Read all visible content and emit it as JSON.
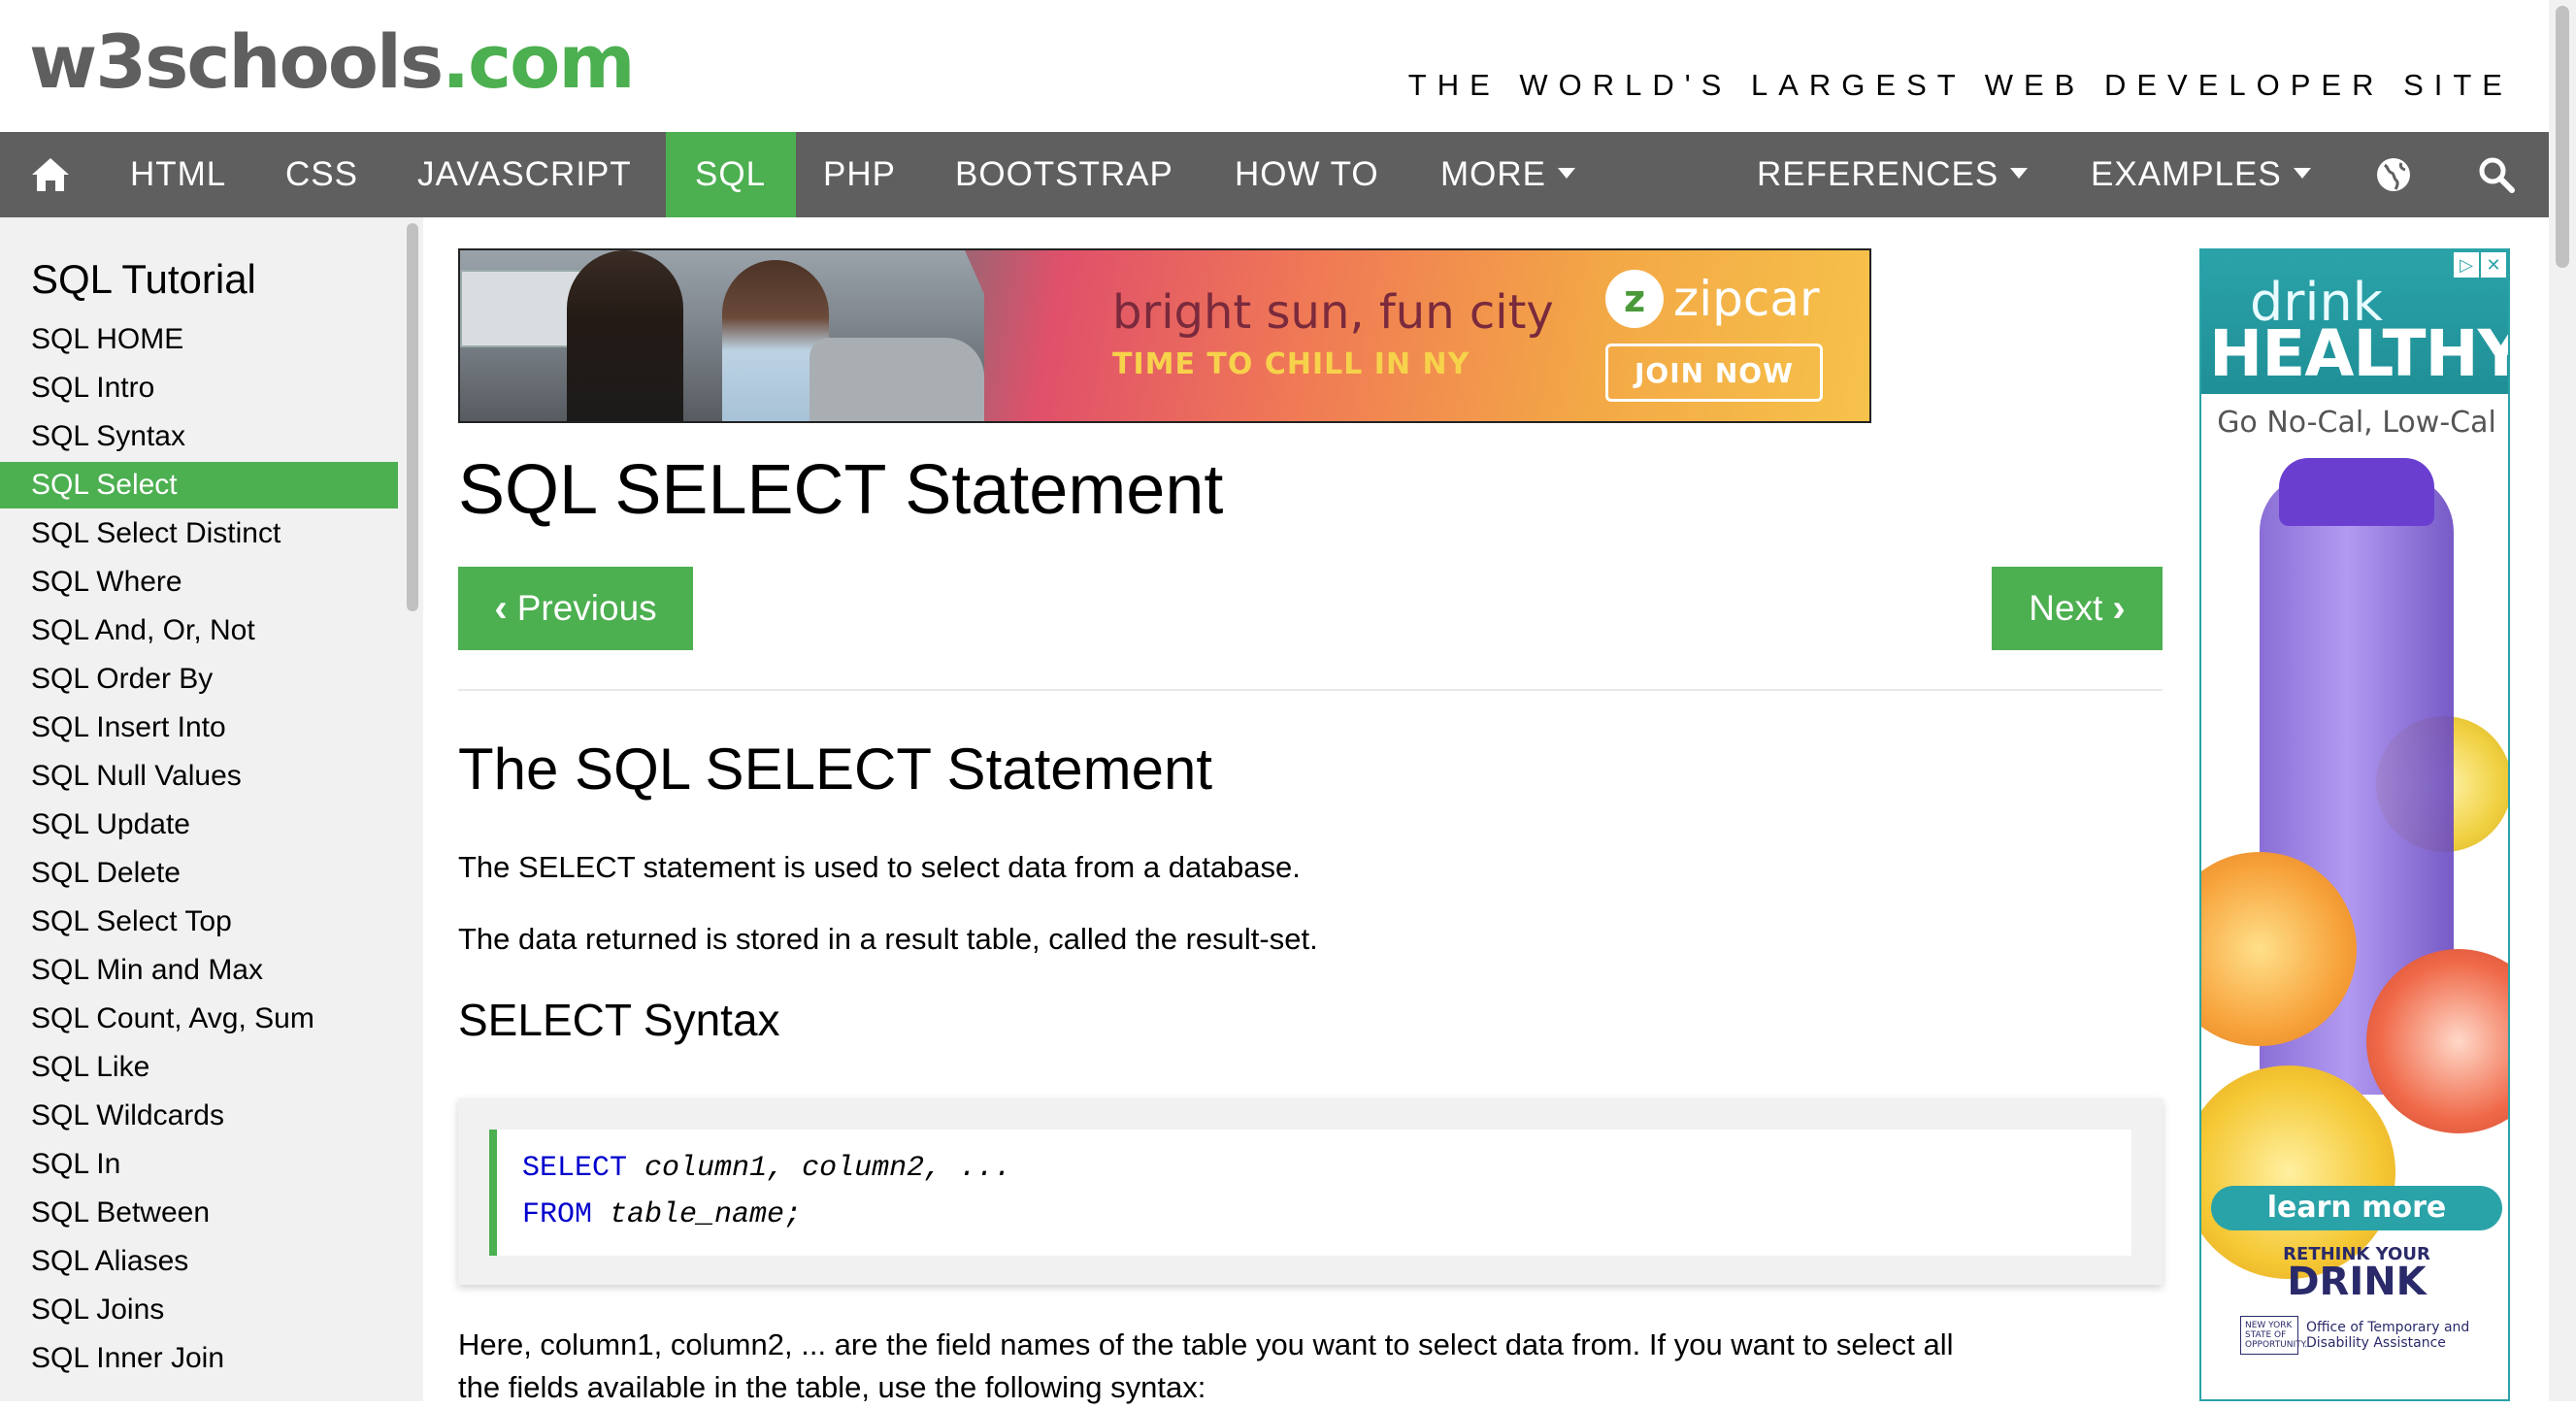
{
  "header": {
    "logo_main": "w3schools",
    "logo_suffix": ".com",
    "tagline": "THE WORLD'S LARGEST WEB DEVELOPER SITE"
  },
  "nav": {
    "items": [
      "HTML",
      "CSS",
      "JAVASCRIPT",
      "SQL",
      "PHP",
      "BOOTSTRAP",
      "HOW TO",
      "MORE"
    ],
    "right_items": [
      "REFERENCES",
      "EXAMPLES"
    ],
    "active": "SQL",
    "icons": [
      "home-icon",
      "globe-icon",
      "search-icon"
    ]
  },
  "sidebar": {
    "title": "SQL Tutorial",
    "items": [
      "SQL HOME",
      "SQL Intro",
      "SQL Syntax",
      "SQL Select",
      "SQL Select Distinct",
      "SQL Where",
      "SQL And, Or, Not",
      "SQL Order By",
      "SQL Insert Into",
      "SQL Null Values",
      "SQL Update",
      "SQL Delete",
      "SQL Select Top",
      "SQL Min and Max",
      "SQL Count, Avg, Sum",
      "SQL Like",
      "SQL Wildcards",
      "SQL In",
      "SQL Between",
      "SQL Aliases",
      "SQL Joins",
      "SQL Inner Join"
    ],
    "active_index": 3
  },
  "ad_banner": {
    "headline": "bright sun, fun city",
    "subline": "TIME TO CHILL IN NY",
    "brand": "zipcar",
    "cta": "JOIN NOW"
  },
  "main": {
    "page_title": "SQL SELECT Statement",
    "prev_label": "Previous",
    "next_label": "Next",
    "section_title": "The SQL SELECT Statement",
    "para1": "The SELECT statement is used to select data from a database.",
    "para2": "The data returned is stored in a result table, called the result-set.",
    "syntax_title": "SELECT Syntax",
    "code": {
      "line1_kw": "SELECT",
      "line1_rest": "column1, column2, ...",
      "line2_kw": "FROM",
      "line2_rest": "table_name;"
    },
    "para3_line1": "Here, column1, column2, ... are the field names of the table you want to select data from. If you want to select all",
    "para3_line2": "the fields available in the table, use the following syntax:"
  },
  "ad_side": {
    "drink": "drink",
    "healthy": "HEALTHY",
    "sub": "Go No-Cal, Low-Cal",
    "learn": "learn more",
    "rethink": "RETHINK YOUR",
    "drink2": "DRINK",
    "ny_seal": "NEW YORK STATE OF OPPORTUNITY.",
    "office": "Office of Temporary and Disability Assistance"
  },
  "colors": {
    "accent": "#4CAF50",
    "nav_bg": "#5f5f5f",
    "sidebar_bg": "#f1f1f1",
    "code_keyword": "#0000cd"
  }
}
